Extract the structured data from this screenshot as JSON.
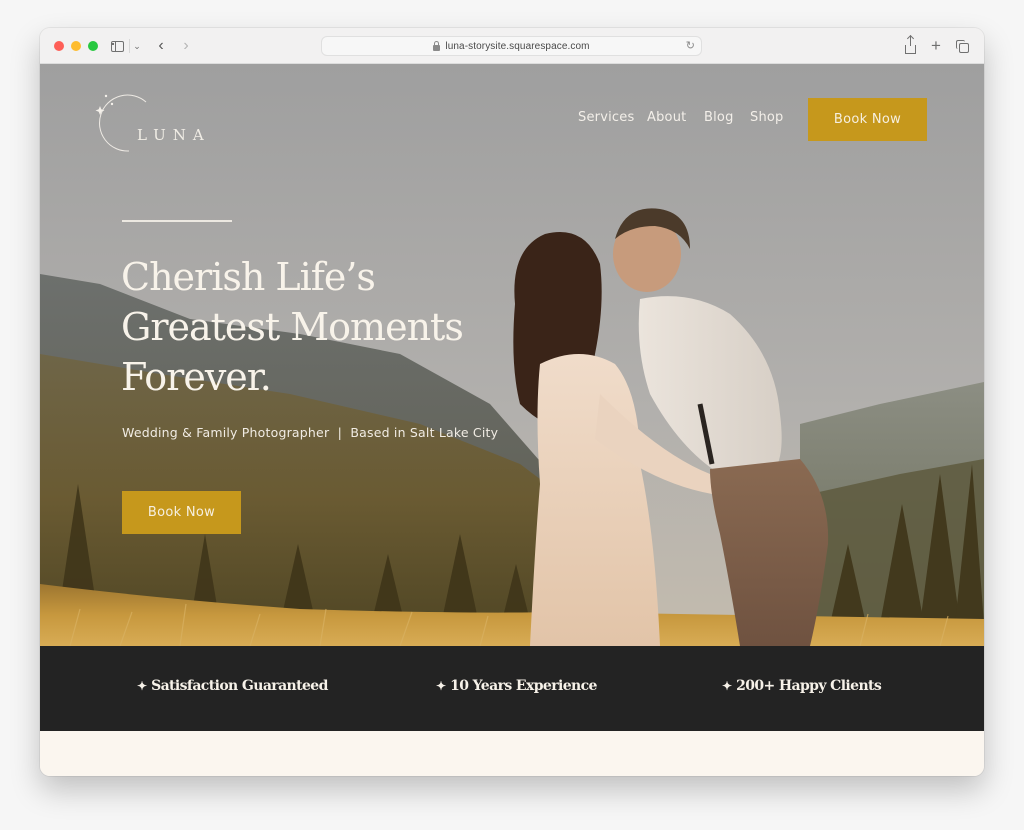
{
  "browser": {
    "url": "luna-storysite.squarespace.com",
    "icons": [
      "close-window",
      "minimize-window",
      "zoom-window",
      "sidebar-icon",
      "chevron-down-icon",
      "back-icon",
      "forward-icon",
      "lock-icon",
      "reload-icon",
      "share-icon",
      "new-tab-icon",
      "tab-overview-icon"
    ]
  },
  "site": {
    "logo_text": "LUNA",
    "nav": {
      "items": [
        {
          "label": "Services"
        },
        {
          "label": "About"
        },
        {
          "label": "Blog"
        },
        {
          "label": "Shop"
        }
      ],
      "cta_label": "Book Now"
    },
    "hero": {
      "headline_lines": [
        "Cherish Life’s",
        "Greatest Moments",
        "Forever."
      ],
      "subline": "Wedding & Family Photographer  |  Based in Salt Lake City",
      "cta_label": "Book Now"
    },
    "features": [
      {
        "icon": "✦",
        "label": "Satisfaction Guaranteed"
      },
      {
        "icon": "✦",
        "label": "10 Years Experience"
      },
      {
        "icon": "✦",
        "label": "200+ Happy Clients"
      }
    ]
  },
  "colors": {
    "accent_gold": "#c6981c",
    "band_dark": "#232323",
    "cream": "#fbf6ef",
    "hero_text": "#f8f3ea"
  }
}
